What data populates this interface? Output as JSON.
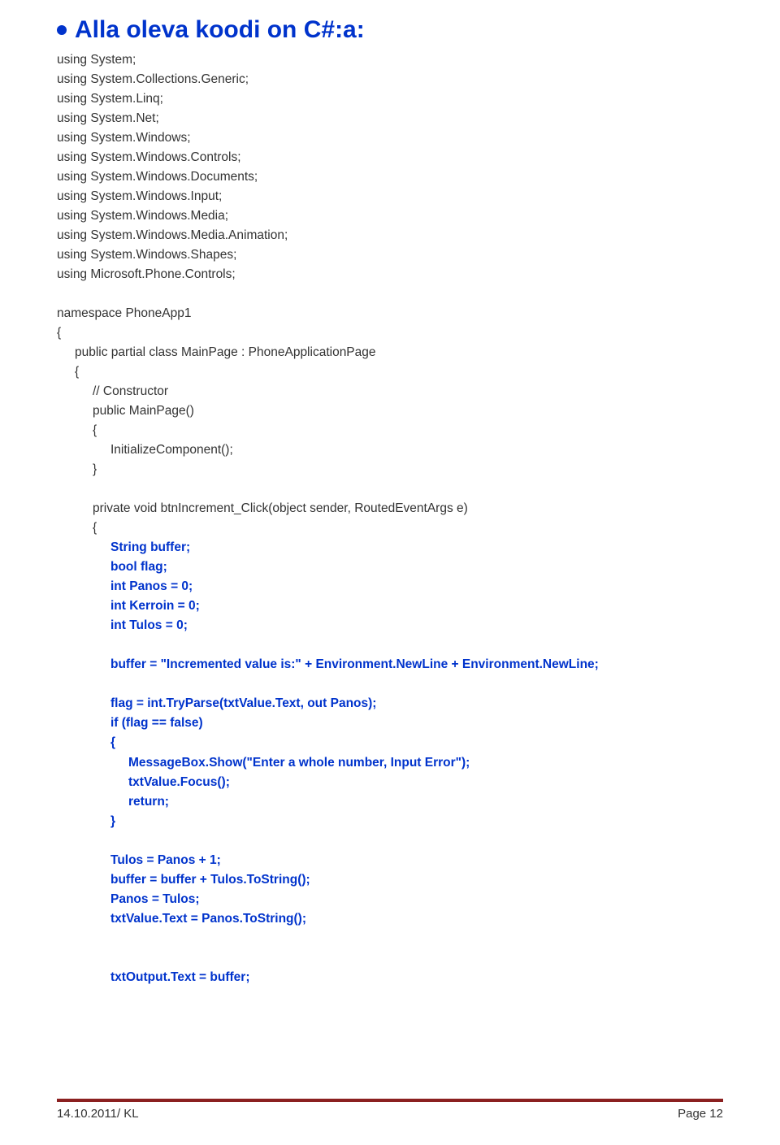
{
  "heading": "Alla oleva koodi on C#:a:",
  "code": {
    "using": [
      "using System;",
      "using System.Collections.Generic;",
      "using System.Linq;",
      "using System.Net;",
      "using System.Windows;",
      "using System.Windows.Controls;",
      "using System.Windows.Documents;",
      "using System.Windows.Input;",
      "using System.Windows.Media;",
      "using System.Windows.Media.Animation;",
      "using System.Windows.Shapes;",
      "using Microsoft.Phone.Controls;"
    ],
    "ns_open": "namespace PhoneApp1",
    "brace_open": "{",
    "class_decl": "public partial class MainPage : PhoneApplicationPage",
    "ctor_comment": "// Constructor",
    "ctor_decl": "public MainPage()",
    "ctor_body": "InitializeComponent();",
    "brace_close": "}",
    "handler_decl": "private void btnIncrement_Click(object sender, RoutedEventArgs e)",
    "decl_buffer": "String buffer;",
    "decl_flag": "bool flag;",
    "decl_panos": "int Panos = 0;",
    "decl_kerroin": "int Kerroin = 0;",
    "decl_tulos": "int Tulos = 0;",
    "buffer_assign": "buffer = \"Incremented value is:\" + Environment.NewLine + Environment.NewLine;",
    "flag_assign": "flag = int.TryParse(txtValue.Text, out Panos);",
    "if_line": "if (flag == false)",
    "msgbox": "MessageBox.Show(\"Enter a whole number, Input Error\");",
    "focus": "txtValue.Focus();",
    "ret": "return;",
    "tulos_assign": "Tulos = Panos + 1;",
    "buffer_append": "buffer = buffer + Tulos.ToString();",
    "panos_assign": "Panos = Tulos;",
    "txtvalue_assign": "txtValue.Text = Panos.ToString();",
    "txtoutput_assign": "txtOutput.Text = buffer;"
  },
  "footer": {
    "left": "14.10.2011/ KL",
    "right": "Page 12"
  }
}
